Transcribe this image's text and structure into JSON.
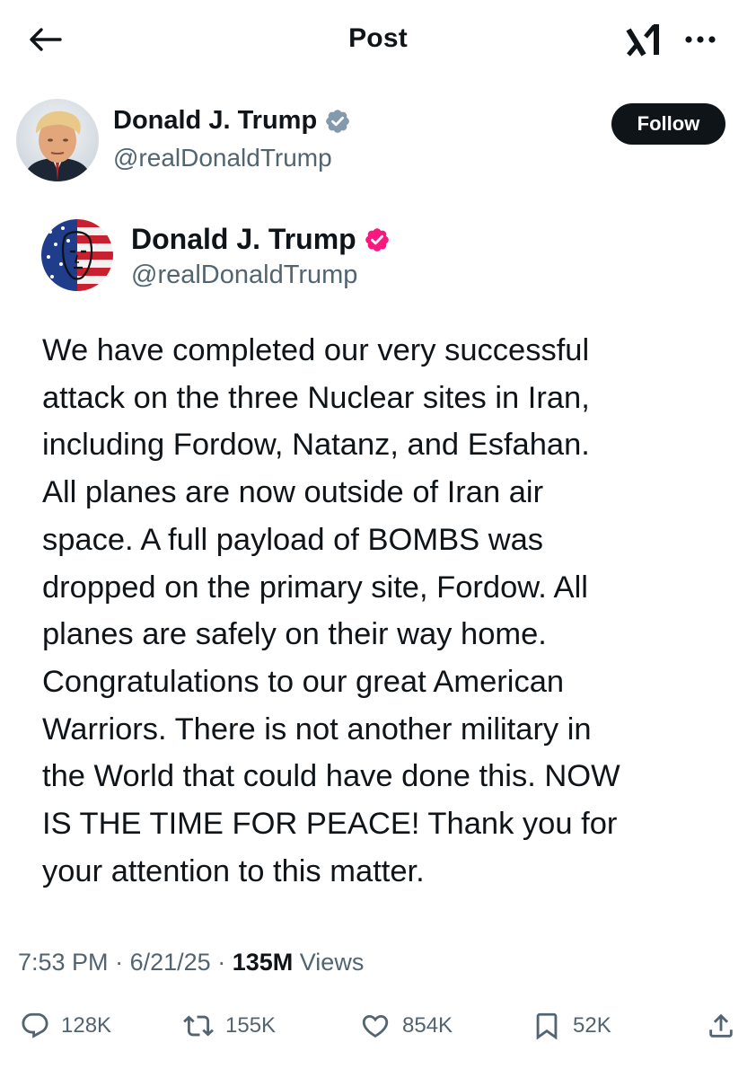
{
  "header": {
    "title": "Post",
    "back_icon": "arrow-left-icon",
    "grok_icon": "grok-icon",
    "more_icon": "more-horizontal-icon"
  },
  "author": {
    "name": "Donald J. Trump",
    "handle": "@realDonaldTrump",
    "verified_color": "#829aab",
    "follow_label": "Follow"
  },
  "embedded": {
    "name": "Donald J. Trump",
    "handle": "@realDonaldTrump",
    "verified_color": "#f91880",
    "lines": [
      "We have completed our very successful",
      "attack on the three Nuclear sites in Iran,",
      "including Fordow, Natanz, and Esfahan.",
      "All planes are now outside of Iran air",
      "space. A full payload of BOMBS was",
      "dropped on the primary site, Fordow. All",
      "planes are safely on their way home.",
      "Congratulations to our great American",
      "Warriors. There is not another military in",
      "the World that could have done this. NOW",
      "IS THE TIME FOR PEACE! Thank you for",
      "your attention to this matter."
    ]
  },
  "meta": {
    "time": "7:53 PM",
    "sep1": "·",
    "date": "6/21/25",
    "sep2": "·",
    "views_count": "135M",
    "views_label": "Views"
  },
  "actions": {
    "replies": "128K",
    "reposts": "155K",
    "likes": "854K",
    "bookmarks": "52K"
  },
  "colors": {
    "text": "#0f1419",
    "secondary": "#536471",
    "follow_bg": "#0f1419"
  }
}
